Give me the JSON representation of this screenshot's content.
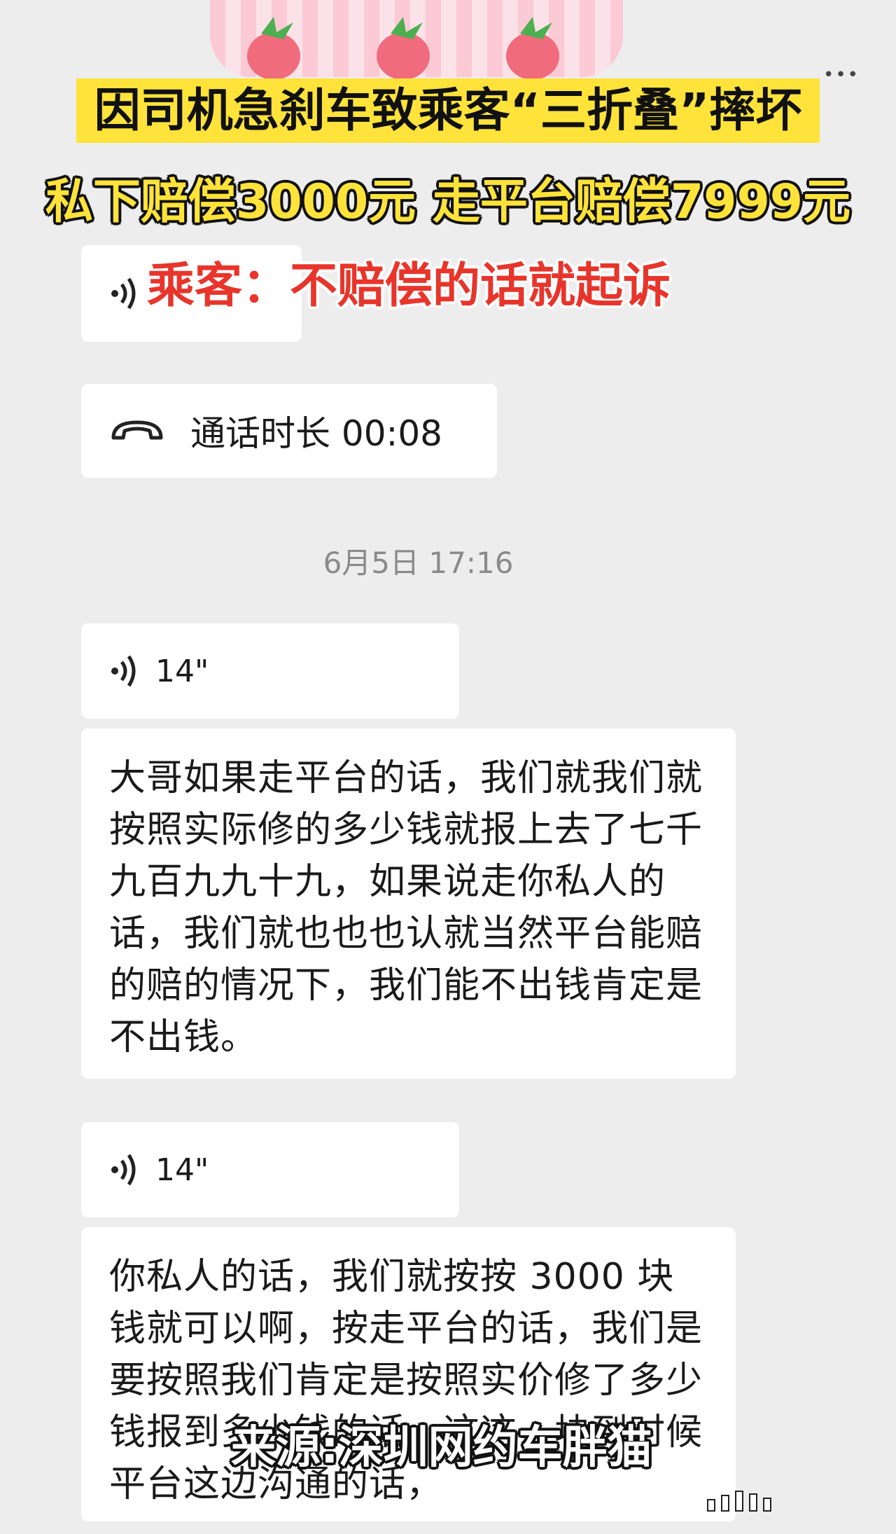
{
  "headline": {
    "line1": "因司机急刹车致乘客“三折叠”摔坏",
    "line2": "私下赔偿3000元 走平台赔偿7999元",
    "line3": "乘客：不赔偿的话就起诉"
  },
  "chat": {
    "top_voice_icon": "voice-wave-icon",
    "call": {
      "icon": "phone-handset-icon",
      "label": "通话时长 00:08"
    },
    "timestamp": "6月5日 17:16",
    "voice1": {
      "duration": "14\""
    },
    "text1": "大哥如果走平台的话，我们就我们就按照实际修的多少钱就报上去了七千九百九九十九，如果说走你私人的话，我们就也也也认就当然平台能赔的赔的情况下，我们能不出钱肯定是不出钱。",
    "voice2": {
      "duration": "14\""
    },
    "text2": "你私人的话，我们就按按 3000 块钱就可以啊，按走平台的话，我们是要按照我们肯定是按照实价修了多少钱报到多少钱的话，这这一块到时候平台这边沟通的话，"
  },
  "overlay": {
    "source": "来源:深圳网约车胖猫"
  },
  "colors": {
    "headline_yellow": "#ffe33a",
    "headline_red": "#e8352b",
    "background": "#ededed"
  }
}
